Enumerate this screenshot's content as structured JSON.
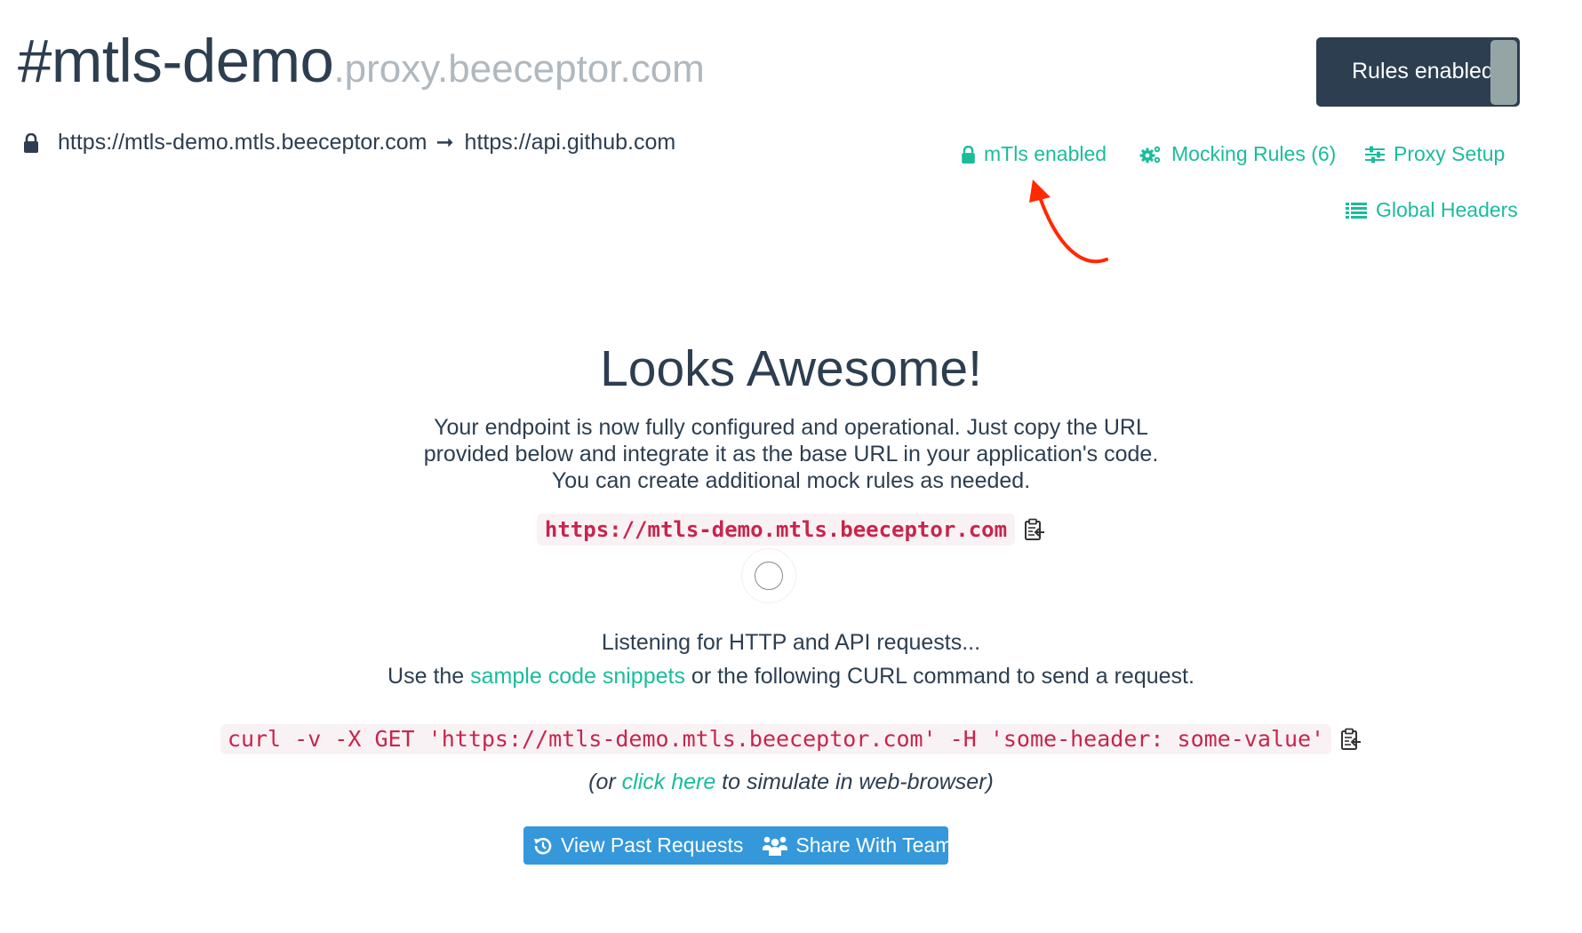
{
  "header": {
    "endpoint_name": "#mtls-demo",
    "endpoint_domain": ".proxy.beeceptor.com",
    "route": {
      "source_url": "https://mtls-demo.mtls.beeceptor.com",
      "arrow": "➞",
      "target_url": "https://api.github.com"
    },
    "rules_toggle": {
      "label": "Rules enabled",
      "state": "on"
    }
  },
  "nav": {
    "mtls": {
      "label": "mTls enabled",
      "icon": "lock-icon"
    },
    "mocking_rules": {
      "label": "Mocking Rules (6)",
      "icon": "gears-icon"
    },
    "proxy_setup": {
      "label": "Proxy Setup",
      "icon": "sliders-icon"
    },
    "global_headers": {
      "label": "Global Headers",
      "icon": "list-icon"
    }
  },
  "annotation": {
    "color": "#ff2a00",
    "target": "mTls enabled"
  },
  "main": {
    "heading": "Looks Awesome!",
    "description": "Your endpoint is now fully configured and operational. Just copy the URL provided below and integrate it as the base URL in your application's code. You can create additional mock rules as needed.",
    "endpoint_url": "https://mtls-demo.mtls.beeceptor.com",
    "listening_text": "Listening for HTTP and API requests...",
    "instruction_prefix": "Use the ",
    "instruction_link": "sample code snippets",
    "instruction_suffix": " or the following CURL command to send a request.",
    "curl_command": "curl -v -X GET 'https://mtls-demo.mtls.beeceptor.com' -H 'some-header: some-value'",
    "hint_prefix": "(or ",
    "hint_link": "click here",
    "hint_suffix": " to simulate in web-browser)"
  },
  "actions": {
    "view_past_requests": "View Past Requests",
    "share_with_teammates": "Share With Teammates"
  },
  "colors": {
    "primary_text": "#2c3e50",
    "muted_text": "#b0b8bf",
    "accent_teal": "#1abc9c",
    "code_text": "#c7254e",
    "code_bg": "#f9f2f4",
    "button_blue": "#3498db",
    "toggle_bg": "#2c3e50",
    "toggle_knob": "#95a5a6"
  }
}
